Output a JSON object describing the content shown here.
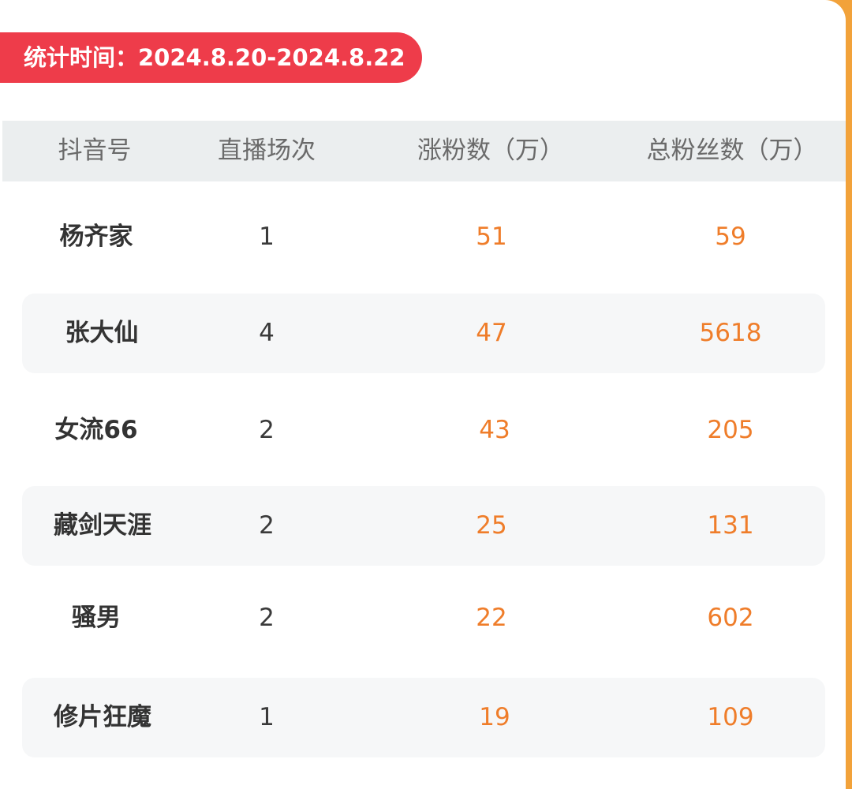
{
  "header_badge": {
    "text": "统计时间：2024.8.20-2024.8.22"
  },
  "table": {
    "columns": [
      "抖音号",
      "直播场次",
      "涨粉数（万）",
      "总粉丝数（万）"
    ],
    "rows": [
      {
        "account": "杨齐家",
        "live_sessions": "1",
        "fans_gained": "51",
        "total_fans": "59"
      },
      {
        "account": "张大仙",
        "live_sessions": "4",
        "fans_gained": "47",
        "total_fans": "5618"
      },
      {
        "account": "女流66",
        "live_sessions": "2",
        "fans_gained": "43",
        "total_fans": "205"
      },
      {
        "account": "藏剑天涯",
        "live_sessions": "2",
        "fans_gained": "25",
        "total_fans": "131"
      },
      {
        "account": "骚男",
        "live_sessions": "2",
        "fans_gained": "22",
        "total_fans": "602"
      },
      {
        "account": "修片狂魔",
        "live_sessions": "1",
        "fans_gained": "19",
        "total_fans": "109"
      }
    ]
  },
  "colors": {
    "badge_red": "#ee3c4a",
    "value_orange": "#ef7d2a",
    "header_gray": "#ebeeef",
    "page_orange": "#f2a23a"
  }
}
